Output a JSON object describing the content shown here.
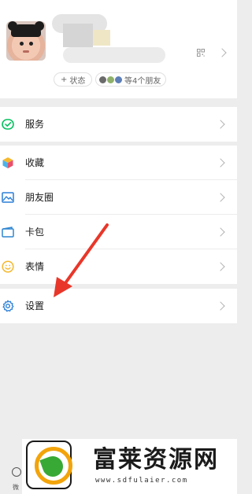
{
  "profile": {
    "status_plus": "+",
    "status_label": "状态",
    "friends_label": "等4个朋友"
  },
  "menu": {
    "services": "服务",
    "favorites": "收藏",
    "moments": "朋友圈",
    "cards": "卡包",
    "stickers": "表情",
    "settings": "设置"
  },
  "promo": {
    "brand": "富莱资源网",
    "url": "www.sdfulaier.com"
  },
  "tabbar": {
    "partial_label": "微"
  },
  "icons": {
    "services": "services-icon",
    "favorites": "favorites-cube-icon",
    "moments": "moments-image-icon",
    "cards": "card-wallet-icon",
    "stickers": "smiley-icon",
    "settings": "gear-icon",
    "qr": "qr-code-icon"
  },
  "colors": {
    "background": "#ededed",
    "arrow": "#e8372a",
    "services_green": "#07c160",
    "moments_blue": "#2b7fd6",
    "cards_blue": "#2f86d1",
    "stickers_yellow": "#f5b82e",
    "settings_blue": "#2b7fd6"
  }
}
